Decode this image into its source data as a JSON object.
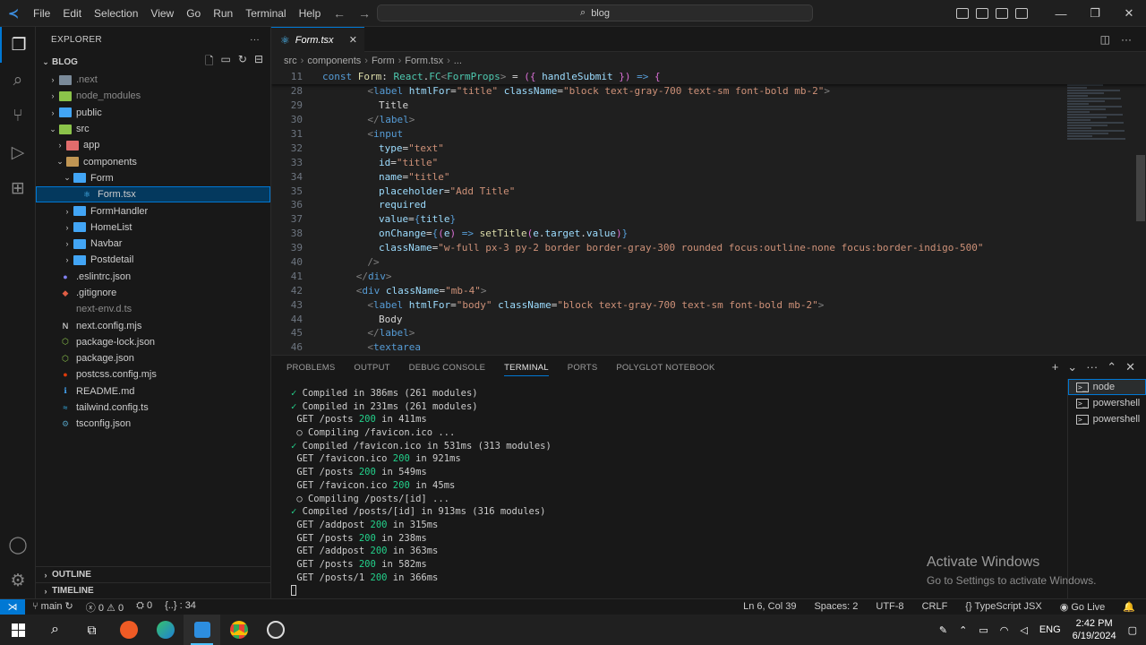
{
  "titlebar": {
    "menu": [
      "File",
      "Edit",
      "Selection",
      "View",
      "Go",
      "Run",
      "Terminal",
      "Help"
    ],
    "search_text": "blog"
  },
  "explorer": {
    "header": "EXPLORER",
    "root": "BLOG",
    "items": [
      {
        "label": ".next",
        "depth": 1,
        "kind": "folder",
        "color": "gray",
        "chev": "›",
        "dim": true
      },
      {
        "label": "node_modules",
        "depth": 1,
        "kind": "folder",
        "color": "green",
        "chev": "›",
        "dim": true
      },
      {
        "label": "public",
        "depth": 1,
        "kind": "folder",
        "color": "blue",
        "chev": "›"
      },
      {
        "label": "src",
        "depth": 1,
        "kind": "folder",
        "color": "green",
        "chev": "⌄"
      },
      {
        "label": "app",
        "depth": 2,
        "kind": "folder",
        "color": "red",
        "chev": "›"
      },
      {
        "label": "components",
        "depth": 2,
        "kind": "folder",
        "color": "",
        "chev": "⌄"
      },
      {
        "label": "Form",
        "depth": 3,
        "kind": "folder",
        "color": "blue",
        "chev": "⌄"
      },
      {
        "label": "Form.tsx",
        "depth": 4,
        "kind": "file",
        "glyph": "⚛",
        "gcolor": "#4fc1ff",
        "selected": true
      },
      {
        "label": "FormHandler",
        "depth": 3,
        "kind": "folder",
        "color": "blue",
        "chev": "›"
      },
      {
        "label": "HomeList",
        "depth": 3,
        "kind": "folder",
        "color": "blue",
        "chev": "›"
      },
      {
        "label": "Navbar",
        "depth": 3,
        "kind": "folder",
        "color": "blue",
        "chev": "›"
      },
      {
        "label": "Postdetail",
        "depth": 3,
        "kind": "folder",
        "color": "blue",
        "chev": "›"
      },
      {
        "label": ".eslintrc.json",
        "depth": 1,
        "kind": "file",
        "glyph": "●",
        "gcolor": "#8080f0"
      },
      {
        "label": ".gitignore",
        "depth": 1,
        "kind": "file",
        "glyph": "◆",
        "gcolor": "#e05d44"
      },
      {
        "label": "next-env.d.ts",
        "depth": 1,
        "kind": "file",
        "glyph": "",
        "gcolor": "#519aba",
        "dim": true
      },
      {
        "label": "next.config.mjs",
        "depth": 1,
        "kind": "file",
        "glyph": "N",
        "gcolor": "#ffffff"
      },
      {
        "label": "package-lock.json",
        "depth": 1,
        "kind": "file",
        "glyph": "⬡",
        "gcolor": "#8bc34a"
      },
      {
        "label": "package.json",
        "depth": 1,
        "kind": "file",
        "glyph": "⬡",
        "gcolor": "#8bc34a"
      },
      {
        "label": "postcss.config.mjs",
        "depth": 1,
        "kind": "file",
        "glyph": "●",
        "gcolor": "#dd3a0a"
      },
      {
        "label": "README.md",
        "depth": 1,
        "kind": "file",
        "glyph": "ℹ",
        "gcolor": "#42a5f5"
      },
      {
        "label": "tailwind.config.ts",
        "depth": 1,
        "kind": "file",
        "glyph": "≈",
        "gcolor": "#38bdf8"
      },
      {
        "label": "tsconfig.json",
        "depth": 1,
        "kind": "file",
        "glyph": "⚙",
        "gcolor": "#519aba"
      }
    ],
    "outline": "OUTLINE",
    "timeline": "TIMELINE"
  },
  "editor": {
    "tab_label": "Form.tsx",
    "breadcrumb": [
      "src",
      "components",
      "Form",
      "Form.tsx",
      "..."
    ],
    "lines": [
      {
        "n": "11",
        "sticky": true,
        "tokens": [
          [
            "kw",
            "const "
          ],
          [
            "fn",
            "Form"
          ],
          [
            "text",
            ": "
          ],
          [
            "type",
            "React"
          ],
          [
            "text",
            "."
          ],
          [
            "type",
            "FC"
          ],
          [
            "punc",
            "<"
          ],
          [
            "type",
            "FormProps"
          ],
          [
            "punc",
            "> "
          ],
          [
            "text",
            "= "
          ],
          [
            "brace",
            "({ "
          ],
          [
            "attr",
            "handleSubmit"
          ],
          [
            "brace",
            " }) "
          ],
          [
            "kw",
            "=> "
          ],
          [
            "brace",
            "{"
          ]
        ]
      },
      {
        "n": "28",
        "indent": 4,
        "tokens": [
          [
            "punc",
            "<"
          ],
          [
            "tag",
            "label "
          ],
          [
            "attr",
            "htmlFor"
          ],
          [
            "text",
            "="
          ],
          [
            "str",
            "\"title\" "
          ],
          [
            "attr",
            "className"
          ],
          [
            "text",
            "="
          ],
          [
            "str",
            "\"block text-gray-700 text-sm font-bold mb-2\""
          ],
          [
            "punc",
            ">"
          ]
        ]
      },
      {
        "n": "29",
        "indent": 5,
        "tokens": [
          [
            "text",
            "Title"
          ]
        ]
      },
      {
        "n": "30",
        "indent": 4,
        "tokens": [
          [
            "punc",
            "</"
          ],
          [
            "tag",
            "label"
          ],
          [
            "punc",
            ">"
          ]
        ]
      },
      {
        "n": "31",
        "indent": 4,
        "tokens": [
          [
            "punc",
            "<"
          ],
          [
            "tag",
            "input"
          ]
        ]
      },
      {
        "n": "32",
        "indent": 5,
        "tokens": [
          [
            "attr",
            "type"
          ],
          [
            "text",
            "="
          ],
          [
            "str",
            "\"text\""
          ]
        ]
      },
      {
        "n": "33",
        "indent": 5,
        "tokens": [
          [
            "attr",
            "id"
          ],
          [
            "text",
            "="
          ],
          [
            "str",
            "\"title\""
          ]
        ]
      },
      {
        "n": "34",
        "indent": 5,
        "tokens": [
          [
            "attr",
            "name"
          ],
          [
            "text",
            "="
          ],
          [
            "str",
            "\"title\""
          ]
        ]
      },
      {
        "n": "35",
        "indent": 5,
        "tokens": [
          [
            "attr",
            "placeholder"
          ],
          [
            "text",
            "="
          ],
          [
            "str",
            "\"Add Title\""
          ]
        ]
      },
      {
        "n": "36",
        "indent": 5,
        "tokens": [
          [
            "attr",
            "required"
          ]
        ]
      },
      {
        "n": "37",
        "indent": 5,
        "tokens": [
          [
            "attr",
            "value"
          ],
          [
            "text",
            "="
          ],
          [
            "tag",
            "{"
          ],
          [
            "attr",
            "title"
          ],
          [
            "tag",
            "}"
          ]
        ]
      },
      {
        "n": "38",
        "indent": 5,
        "tokens": [
          [
            "attr",
            "onChange"
          ],
          [
            "text",
            "="
          ],
          [
            "tag",
            "{"
          ],
          [
            "brace",
            "("
          ],
          [
            "attr",
            "e"
          ],
          [
            "brace",
            ") "
          ],
          [
            "kw",
            "=> "
          ],
          [
            "fn",
            "setTitle"
          ],
          [
            "brace",
            "("
          ],
          [
            "attr",
            "e"
          ],
          [
            "text",
            "."
          ],
          [
            "attr",
            "target"
          ],
          [
            "text",
            "."
          ],
          [
            "attr",
            "value"
          ],
          [
            "brace",
            ")"
          ],
          [
            "tag",
            "}"
          ]
        ]
      },
      {
        "n": "39",
        "indent": 5,
        "tokens": [
          [
            "attr",
            "className"
          ],
          [
            "text",
            "="
          ],
          [
            "str",
            "\"w-full px-3 py-2 border border-gray-300 rounded focus:outline-none focus:border-indigo-500\""
          ]
        ]
      },
      {
        "n": "40",
        "indent": 4,
        "tokens": [
          [
            "punc",
            "/>"
          ]
        ]
      },
      {
        "n": "41",
        "indent": 3,
        "tokens": [
          [
            "punc",
            "</"
          ],
          [
            "tag",
            "div"
          ],
          [
            "punc",
            ">"
          ]
        ]
      },
      {
        "n": "42",
        "indent": 3,
        "tokens": [
          [
            "punc",
            "<"
          ],
          [
            "tag",
            "div "
          ],
          [
            "attr",
            "className"
          ],
          [
            "text",
            "="
          ],
          [
            "str",
            "\"mb-4\""
          ],
          [
            "punc",
            ">"
          ]
        ]
      },
      {
        "n": "43",
        "indent": 4,
        "tokens": [
          [
            "punc",
            "<"
          ],
          [
            "tag",
            "label "
          ],
          [
            "attr",
            "htmlFor"
          ],
          [
            "text",
            "="
          ],
          [
            "str",
            "\"body\" "
          ],
          [
            "attr",
            "className"
          ],
          [
            "text",
            "="
          ],
          [
            "str",
            "\"block text-gray-700 text-sm font-bold mb-2\""
          ],
          [
            "punc",
            ">"
          ]
        ]
      },
      {
        "n": "44",
        "indent": 5,
        "tokens": [
          [
            "text",
            "Body"
          ]
        ]
      },
      {
        "n": "45",
        "indent": 4,
        "tokens": [
          [
            "punc",
            "</"
          ],
          [
            "tag",
            "label"
          ],
          [
            "punc",
            ">"
          ]
        ]
      },
      {
        "n": "46",
        "indent": 4,
        "tokens": [
          [
            "punc",
            "<"
          ],
          [
            "tag",
            "textarea"
          ]
        ]
      }
    ]
  },
  "panel": {
    "tabs": [
      "PROBLEMS",
      "OUTPUT",
      "DEBUG CONSOLE",
      "TERMINAL",
      "PORTS",
      "POLYGLOT NOTEBOOK"
    ],
    "active_tab": "TERMINAL",
    "terminal_lines": [
      [
        [
          "ok",
          "✓"
        ],
        [
          "text",
          " Compiled in 386ms (261 modules)"
        ]
      ],
      [
        [
          "ok",
          "✓"
        ],
        [
          "text",
          " Compiled in 231ms (261 modules)"
        ]
      ],
      [
        [
          "text",
          " GET /posts "
        ],
        [
          "green",
          "200"
        ],
        [
          "text",
          " in 411ms"
        ]
      ],
      [
        [
          "text",
          " ○ Compiling /favicon.ico ..."
        ]
      ],
      [
        [
          "ok",
          "✓"
        ],
        [
          "text",
          " Compiled /favicon.ico in 531ms (313 modules)"
        ]
      ],
      [
        [
          "text",
          " GET /favicon.ico "
        ],
        [
          "green",
          "200"
        ],
        [
          "text",
          " in 921ms"
        ]
      ],
      [
        [
          "text",
          " GET /posts "
        ],
        [
          "green",
          "200"
        ],
        [
          "text",
          " in 549ms"
        ]
      ],
      [
        [
          "text",
          " GET /favicon.ico "
        ],
        [
          "green",
          "200"
        ],
        [
          "text",
          " in 45ms"
        ]
      ],
      [
        [
          "text",
          " ○ Compiling /posts/[id] ..."
        ]
      ],
      [
        [
          "ok",
          "✓"
        ],
        [
          "text",
          " Compiled /posts/[id] in 913ms (316 modules)"
        ]
      ],
      [
        [
          "text",
          " GET /addpost "
        ],
        [
          "green",
          "200"
        ],
        [
          "text",
          " in 315ms"
        ]
      ],
      [
        [
          "text",
          " GET /posts "
        ],
        [
          "green",
          "200"
        ],
        [
          "text",
          " in 238ms"
        ]
      ],
      [
        [
          "text",
          " GET /addpost "
        ],
        [
          "green",
          "200"
        ],
        [
          "text",
          " in 363ms"
        ]
      ],
      [
        [
          "text",
          " GET /posts "
        ],
        [
          "green",
          "200"
        ],
        [
          "text",
          " in 582ms"
        ]
      ],
      [
        [
          "text",
          " GET /posts/1 "
        ],
        [
          "green",
          "200"
        ],
        [
          "text",
          " in 366ms"
        ]
      ]
    ],
    "terminals": [
      "node",
      "powershell",
      "powershell"
    ],
    "watermark_title": "Activate Windows",
    "watermark_sub": "Go to Settings to activate Windows."
  },
  "statusbar": {
    "branch": "main",
    "errors": "0",
    "warnings": "0",
    "ports": "0",
    "selection": "{..} : 34",
    "position": "Ln 6, Col 39",
    "spaces": "Spaces: 2",
    "encoding": "UTF-8",
    "eol": "CRLF",
    "language": "TypeScript JSX",
    "golive": "Go Live"
  },
  "taskbar": {
    "lang": "ENG",
    "time": "2:42 PM",
    "date": "6/19/2024"
  }
}
